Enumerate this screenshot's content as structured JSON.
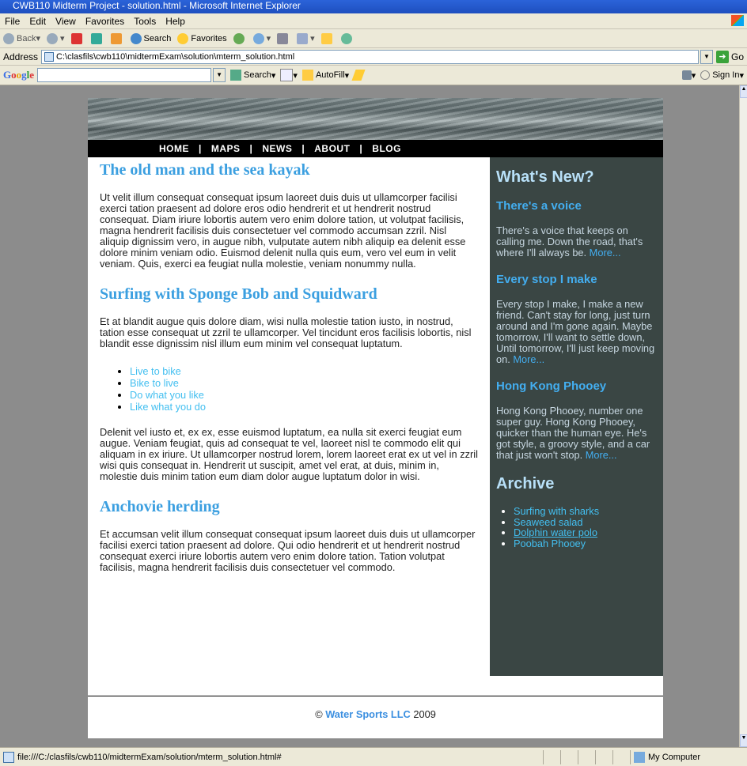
{
  "window": {
    "title": "CWB110 Midterm Project - solution.html - Microsoft Internet Explorer"
  },
  "menu": [
    {
      "label": "File"
    },
    {
      "label": "Edit"
    },
    {
      "label": "View"
    },
    {
      "label": "Favorites"
    },
    {
      "label": "Tools"
    },
    {
      "label": "Help"
    }
  ],
  "toolbar": {
    "back": "Back",
    "search": "Search",
    "favorites": "Favorites"
  },
  "address": {
    "label": "Address",
    "value": "C:\\clasfils\\cwb110\\midtermExam\\solution\\mterm_solution.html",
    "go": "Go"
  },
  "googlebar": {
    "logo": "Google",
    "search": "Search",
    "autofill": "AutoFill",
    "signin": "Sign In"
  },
  "nav": [
    "HOME",
    "MAPS",
    "NEWS",
    "ABOUT",
    "BLOG"
  ],
  "main": {
    "h1": "The old man and the sea kayak",
    "p1": "Ut velit illum consequat consequat ipsum laoreet duis duis ut ullamcorper facilisi exerci tation praesent ad dolore eros odio hendrerit et ut hendrerit nostrud consequat. Diam iriure lobortis autem vero enim dolore tation, ut volutpat facilisis, magna hendrerit facilisis duis consectetuer vel commodo accumsan zzril. Nisl aliquip dignissim vero, in augue nibh, vulputate autem nibh aliquip ea delenit esse dolore minim veniam odio. Euismod delenit nulla quis eum, vero vel eum in velit veniam. Quis, exerci ea feugiat nulla molestie, veniam nonummy nulla.",
    "h2": "Surfing with Sponge Bob and Squidward",
    "p2": "Et at blandit augue quis dolore diam, wisi nulla molestie tation iusto, in nostrud, tation esse consequat ut zzril te ullamcorper. Vel tincidunt eros facilisis lobortis, nisl blandit esse dignissim nisl illum eum minim vel consequat luptatum.",
    "list": [
      "Live to bike",
      "Bike to live",
      "Do what you like",
      "Like what you do"
    ],
    "p3": "Delenit vel iusto et, ex ex, esse euismod luptatum, ea nulla sit exerci feugiat eum augue. Veniam feugiat, quis ad consequat te vel, laoreet nisl te commodo elit qui aliquam in ex iriure. Ut ullamcorper nostrud lorem, lorem laoreet erat ex ut vel in zzril wisi quis consequat in. Hendrerit ut suscipit, amet vel erat, at duis, minim in, molestie duis minim tation eum diam dolor augue luptatum dolor in wisi.",
    "h3": "Anchovie herding",
    "p4": "Et accumsan velit illum consequat consequat ipsum laoreet duis duis ut ullamcorper facilisi exerci tation praesent ad dolore. Qui odio hendrerit et ut hendrerit nostrud consequat exerci iriure lobortis autem vero enim dolore tation. Tation volutpat facilisis, magna hendrerit facilisis duis consectetuer vel commodo."
  },
  "sidebar": {
    "title": "What's New?",
    "items": [
      {
        "heading": "There's a voice",
        "text": "There's a voice that keeps on calling me. Down the road, that's where I'll always be. ",
        "more": "More..."
      },
      {
        "heading": "Every stop I make",
        "text": "Every stop I make, I make a new friend. Can't stay for long, just turn around and I'm gone again. Maybe tomorrow, I'll want to settle down, Until tomorrow, I'll just keep moving on. ",
        "more": "More..."
      },
      {
        "heading": "Hong Kong Phooey",
        "text": "Hong Kong Phooey, number one super guy. Hong Kong Phooey, quicker than the human eye. He's got style, a groovy style, and a car that just won't stop. ",
        "more": "More..."
      }
    ],
    "archive_title": "Archive",
    "archive": [
      "Surfing with sharks",
      "Seaweed salad",
      "Dolphin water polo",
      "Poobah Phooey"
    ]
  },
  "footer": {
    "copy": "©",
    "brand": "Water Sports LLC",
    "year": "2009"
  },
  "status": {
    "url": "file:///C:/clasfils/cwb110/midtermExam/solution/mterm_solution.html#",
    "zone": "My Computer"
  }
}
